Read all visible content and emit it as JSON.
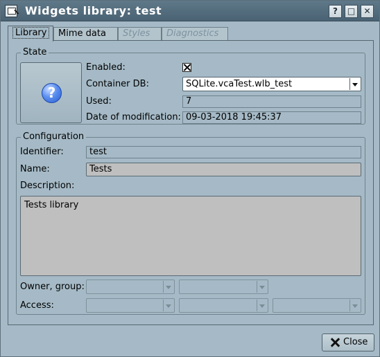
{
  "window": {
    "title": "Widgets library: test",
    "buttons": {
      "help": "?",
      "maximize": "□",
      "close": "✕"
    }
  },
  "tabs": [
    {
      "label": "Library",
      "state": "active"
    },
    {
      "label": "Mime data",
      "state": "normal"
    },
    {
      "label": "Styles",
      "state": "disabled"
    },
    {
      "label": "Diagnostics",
      "state": "disabled"
    }
  ],
  "state_group": {
    "title": "State",
    "icon": "help-icon",
    "enabled_label": "Enabled:",
    "enabled_checked": true,
    "container_db_label": "Container DB:",
    "container_db_value": "SQLite.vcaTest.wlb_test",
    "used_label": "Used:",
    "used_value": "7",
    "date_label": "Date of modification:",
    "date_value": "09-03-2018 19:45:37"
  },
  "config_group": {
    "title": "Configuration",
    "identifier_label": "Identifier:",
    "identifier_value": "test",
    "name_label": "Name:",
    "name_value": "Tests",
    "description_label": "Description:",
    "description_value": "Tests library",
    "owner_label": "Owner, group:",
    "owner_value": "",
    "group_value": "",
    "access_label": "Access:",
    "access_user": "",
    "access_group": "",
    "access_other": ""
  },
  "footer": {
    "close_label": "Close"
  }
}
